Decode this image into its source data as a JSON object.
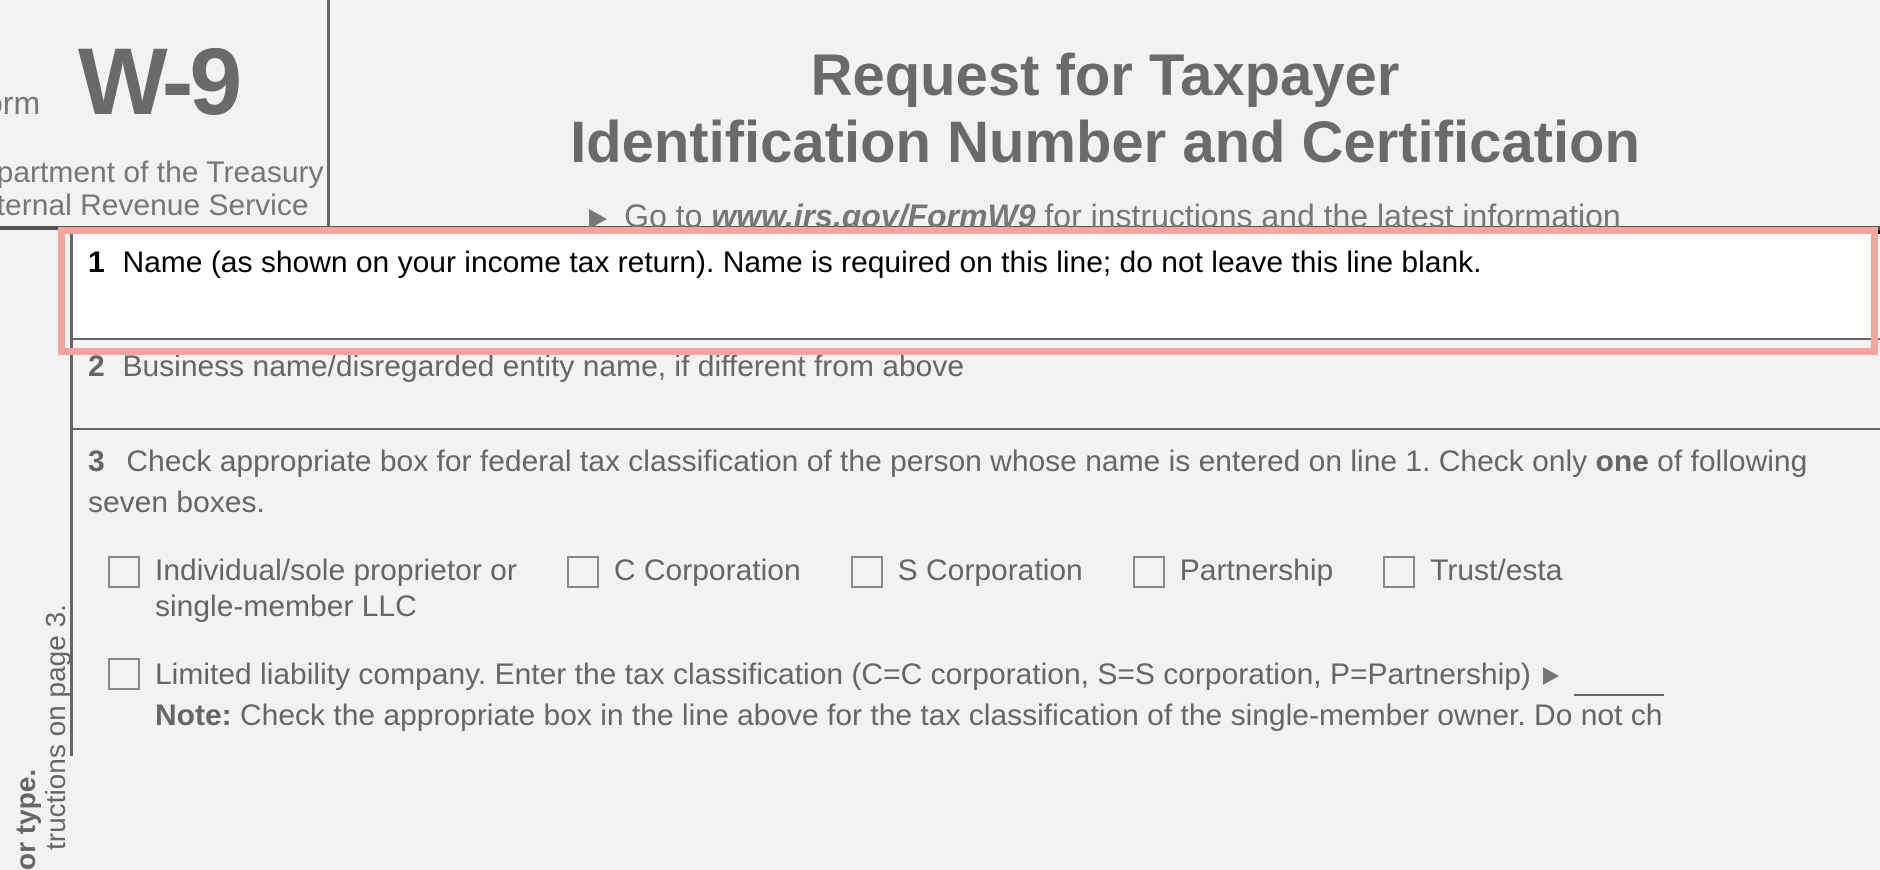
{
  "header": {
    "form_label": "orm",
    "form_number": "W-9",
    "dept_line1": "epartment of the Treasury",
    "dept_line2": "nternal Revenue Service",
    "title_line1": "Request for Taxpayer",
    "title_line2": "Identification Number and Certification",
    "goto_prefix": "Go to ",
    "goto_url": "www.irs.gov/FormW9",
    "goto_suffix": " for instructions and the latest information"
  },
  "sidebar": {
    "text1": "tructions on page 3.",
    "text2": "or type."
  },
  "fields": {
    "line1": {
      "number": "1",
      "text": "Name (as shown on your income tax return). Name is required on this line; do not leave this line blank."
    },
    "line2": {
      "number": "2",
      "text": "Business name/disregarded entity name, if different from above"
    },
    "line3": {
      "number": "3",
      "text_part1": "Check appropriate box for federal tax classification of the person whose name is entered on line 1. Check only ",
      "text_bold": "one",
      "text_part2": " of following seven boxes."
    }
  },
  "checkboxes": {
    "individual": {
      "line1": "Individual/sole proprietor or",
      "line2": "single-member LLC"
    },
    "c_corp": "C Corporation",
    "s_corp": "S Corporation",
    "partnership": "Partnership",
    "trust": "Trust/esta"
  },
  "llc": {
    "text": "Limited liability company. Enter the tax classification (C=C corporation, S=S corporation, P=Partnership)",
    "note_label": "Note:",
    "note_text": " Check the appropriate box in the line above for the tax classification of the single-member owner.  Do not ch"
  }
}
